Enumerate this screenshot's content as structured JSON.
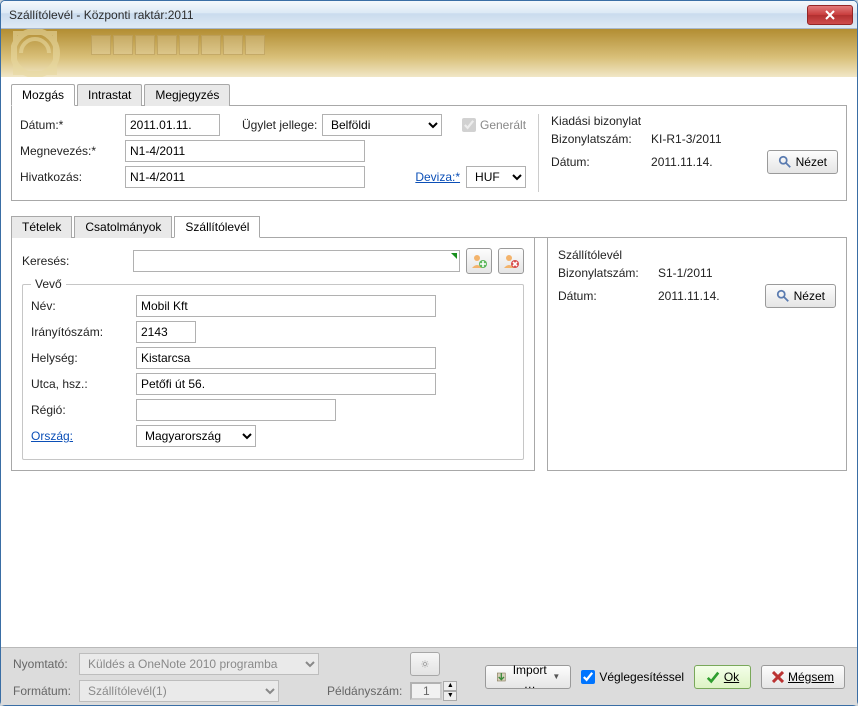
{
  "window": {
    "title": "Szállítólevél - Központi raktár:2011"
  },
  "main_tabs": [
    "Mozgás",
    "Intrastat",
    "Megjegyzés"
  ],
  "mozgas": {
    "datum_label": "Dátum:*",
    "datum": "2011.01.11.",
    "megnevezes_label": "Megnevezés:*",
    "megnevezes": "N1-4/2011",
    "hivatkozas_label": "Hivatkozás:",
    "hivatkozas": "N1-4/2011",
    "ugylet_label": "Ügylet jellege:",
    "ugylet": "Belföldi",
    "generalt_label": "Generált",
    "deviza_label": "Deviza:*",
    "deviza": "HUF"
  },
  "kiadasi": {
    "title": "Kiadási bizonylat",
    "szam_label": "Bizonylatszám:",
    "szam": "KI-R1-3/2011",
    "datum_label": "Dátum:",
    "datum": "2011.11.14.",
    "nezet": "Nézet"
  },
  "sub_tabs": [
    "Tételek",
    "Csatolmányok",
    "Szállítólevél"
  ],
  "szallito": {
    "kereses_label": "Keresés:",
    "title": "Szállítólevél",
    "szam_label": "Bizonylatszám:",
    "szam": "S1-1/2011",
    "datum_label": "Dátum:",
    "datum": "2011.11.14.",
    "nezet": "Nézet"
  },
  "vevo": {
    "legend": "Vevő",
    "nev_label": "Név:",
    "nev": "Mobil Kft",
    "irsz_label": "Irányítószám:",
    "irsz": "2143",
    "helyseg_label": "Helység:",
    "helyseg": "Kistarcsa",
    "utca_label": "Utca, hsz.:",
    "utca": "Petőfi út 56.",
    "regio_label": "Régió:",
    "regio": "",
    "orszag_label": "Ország:",
    "orszag": "Magyarország"
  },
  "bottom": {
    "nyomtato_label": "Nyomtató:",
    "nyomtato": "Küldés a OneNote 2010 programba",
    "formatum_label": "Formátum:",
    "formatum": "Szállítólevél(1)",
    "peldany_label": "Példányszám:",
    "peldany": "1",
    "import": "Import …",
    "vegleg": "Véglegesítéssel",
    "ok": "Ok",
    "megsem": "Mégsem"
  }
}
